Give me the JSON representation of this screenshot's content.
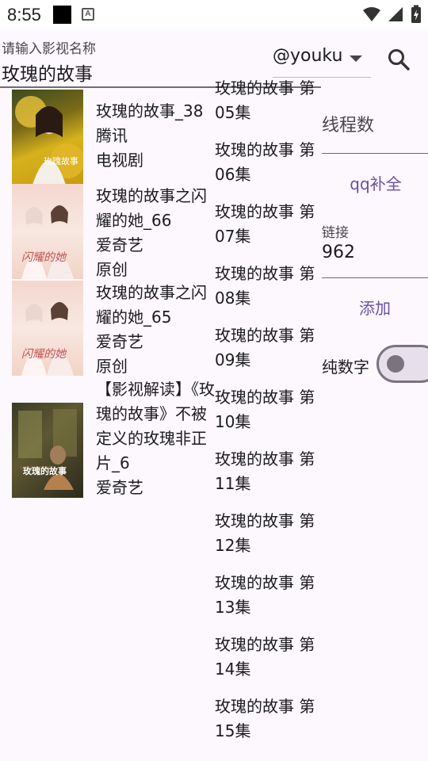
{
  "status_bar": {
    "time": "8:55"
  },
  "search": {
    "hint": "请输入影视名称",
    "value": "玫瑰的故事"
  },
  "source": {
    "value": "@youku"
  },
  "results": [
    {
      "text": "玫瑰的故事_38\n腾讯\n电视剧",
      "poster_caption": "玫瑰故事"
    },
    {
      "text": "玫瑰的故事之闪耀的她_66\n爱奇艺\n原创",
      "poster_caption": "闪耀的她"
    },
    {
      "text": "玫瑰的故事之闪耀的她_65\n爱奇艺\n原创",
      "poster_caption": "闪耀的她"
    },
    {
      "text": "【影视解读】《玫瑰的故事》不被定义的玫瑰非正片_6\n爱奇艺",
      "poster_caption": "玫瑰的故事"
    }
  ],
  "episodes": [
    "玫瑰的故事 第05集",
    "玫瑰的故事 第06集",
    "玫瑰的故事 第07集",
    "玫瑰的故事 第08集",
    "玫瑰的故事 第09集",
    "玫瑰的故事 第10集",
    "玫瑰的故事 第11集",
    "玫瑰的故事 第12集",
    "玫瑰的故事 第13集",
    "玫瑰的故事 第14集",
    "玫瑰的故事 第15集"
  ],
  "panel": {
    "threads_label": "线程数",
    "qq_button": "qq补全",
    "link_label": "链接",
    "link_value": "962",
    "add_button": "添加",
    "digits_label": "纯数字",
    "digits_toggle_on": false
  },
  "colors": {
    "accent": "#6750a4",
    "background": "#fdf8fd"
  }
}
